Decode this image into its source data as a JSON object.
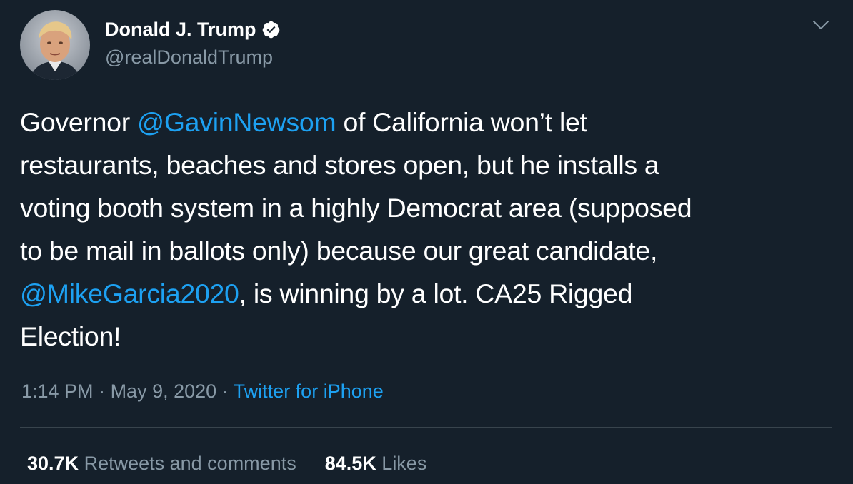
{
  "author": {
    "display_name": "Donald J. Trump",
    "handle": "@realDonaldTrump",
    "verified": true,
    "avatar_icon": "profile-photo"
  },
  "tweet": {
    "segments": [
      {
        "text": "Governor ",
        "type": "text"
      },
      {
        "text": "@GavinNewsom",
        "type": "mention"
      },
      {
        "text": " of California won’t let\nrestaurants, beaches and stores open, but he installs a\nvoting booth system in a highly Democrat area (supposed\nto be mail in ballots only) because our great candidate,\n",
        "type": "text"
      },
      {
        "text": "@MikeGarcia2020",
        "type": "mention"
      },
      {
        "text": ", is winning by a lot. CA25  Rigged\nElection!",
        "type": "text"
      }
    ]
  },
  "meta": {
    "time": "1:14 PM",
    "separator": " · ",
    "date": "May 9, 2020",
    "source": "Twitter for iPhone"
  },
  "stats": {
    "retweets_count": "30.7K",
    "retweets_label": "Retweets and comments",
    "likes_count": "84.5K",
    "likes_label": "Likes"
  },
  "colors": {
    "background": "#15202b",
    "text": "#ffffff",
    "secondary": "#8899a6",
    "accent": "#1da1f2",
    "divider": "#38444d"
  }
}
